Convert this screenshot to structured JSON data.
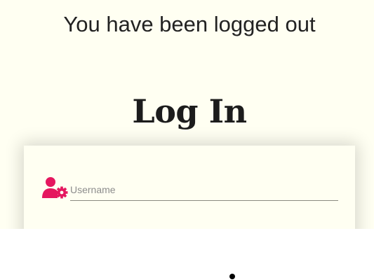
{
  "page": {
    "logout_message": "You have been logged out",
    "title": "Log In"
  },
  "form": {
    "username": {
      "placeholder": "Username",
      "value": "",
      "icon": "user-cog-icon"
    }
  },
  "colors": {
    "page_background": "#fffff2",
    "accent": "#e5175f",
    "text": "#222222"
  }
}
